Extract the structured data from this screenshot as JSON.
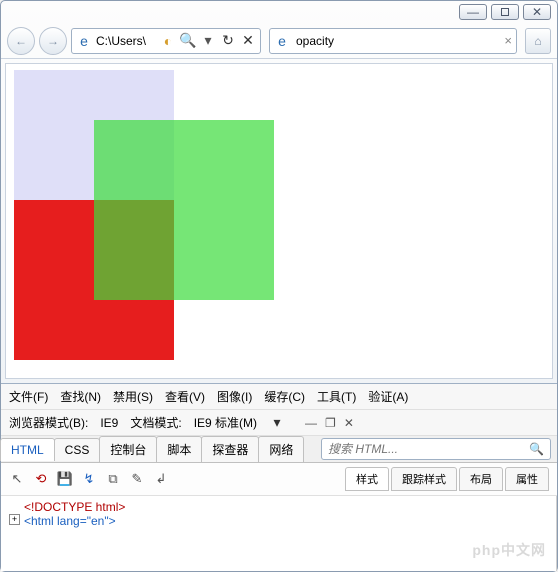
{
  "window": {
    "address": "C:\\Users\\",
    "tab_title": "opacity"
  },
  "menus": {
    "file": "文件(F)",
    "find": "查找(N)",
    "disable": "禁用(S)",
    "view": "查看(V)",
    "images": "图像(I)",
    "cache": "缓存(C)",
    "tools": "工具(T)",
    "validate": "验证(A)"
  },
  "modes": {
    "browser_mode_label": "浏览器模式(B):",
    "browser_mode_value": "IE9",
    "doc_mode_label": "文档模式:",
    "doc_mode_value": "IE9 标准(M)"
  },
  "tabs": {
    "html": "HTML",
    "css": "CSS",
    "console": "控制台",
    "script": "脚本",
    "profiler": "探查器",
    "network": "网络"
  },
  "search": {
    "placeholder": "搜索 HTML..."
  },
  "right_tabs": {
    "style": "样式",
    "trace": "跟踪样式",
    "layout": "布局",
    "props": "属性"
  },
  "dom": {
    "doctype": "<!DOCTYPE html>",
    "html_open": "<html lang=",
    "html_lang_val": "\"en\"",
    "html_close": ">"
  },
  "watermark": "php中文网"
}
